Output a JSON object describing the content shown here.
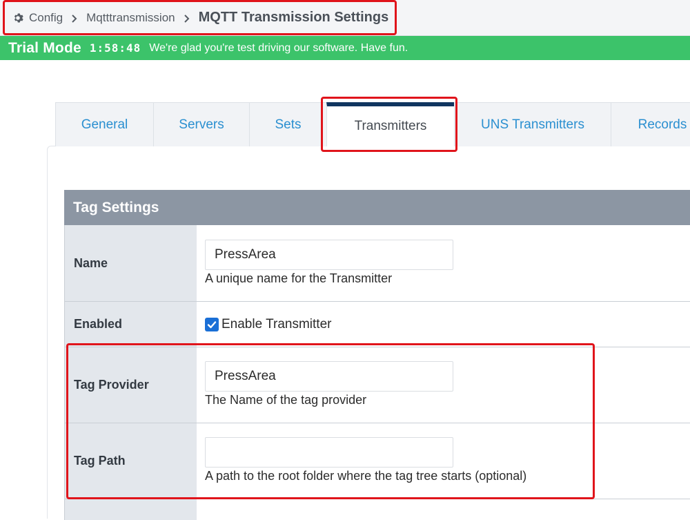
{
  "breadcrumb": {
    "items": [
      "Config",
      "Mqtttransmission"
    ],
    "current": "MQTT Transmission Settings"
  },
  "trial": {
    "label": "Trial Mode",
    "time": "1:58:48",
    "message": "We're glad you're test driving our software. Have fun."
  },
  "tabs": [
    {
      "label": "General"
    },
    {
      "label": "Servers"
    },
    {
      "label": "Sets"
    },
    {
      "label": "Transmitters",
      "active": true
    },
    {
      "label": "UNS Transmitters"
    },
    {
      "label": "Records"
    }
  ],
  "section": {
    "title": "Tag Settings"
  },
  "fields": {
    "name": {
      "label": "Name",
      "value": "PressArea",
      "help": "A unique name for the Transmitter"
    },
    "enabled": {
      "label": "Enabled",
      "checkbox_label": "Enable Transmitter",
      "checked": true
    },
    "tag_provider": {
      "label": "Tag Provider",
      "value": "PressArea",
      "help": "The Name of the tag provider"
    },
    "tag_path": {
      "label": "Tag Path",
      "value": "",
      "help": "A path to the root folder where the tag tree starts (optional)"
    }
  },
  "colors": {
    "trial_bar": "#3cc36a",
    "header_bg": "#8c96a3",
    "tab_active_top": "#103560",
    "link_blue": "#2a8fd0",
    "highlight_red": "#e0141b",
    "checkbox_blue": "#1a6fd6"
  },
  "icons": {
    "breadcrumb_root": "gear-icon",
    "breadcrumb_separator": "chevron-right-icon",
    "checkbox_mark": "checkmark-icon"
  }
}
